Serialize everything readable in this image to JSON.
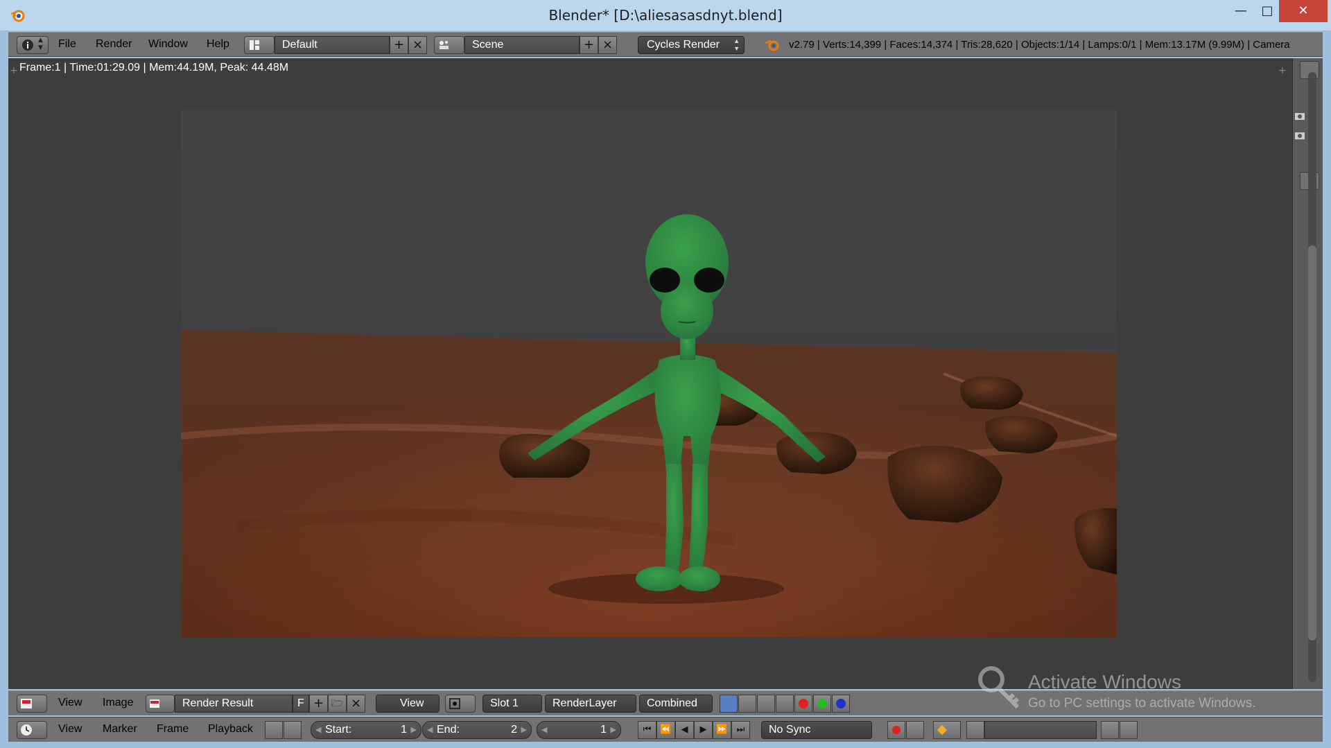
{
  "window": {
    "title": "Blender* [D:\\aliesasasdnyt.blend]"
  },
  "info_header": {
    "menus": [
      "File",
      "Render",
      "Window",
      "Help"
    ],
    "screen_layout": "Default",
    "scene": "Scene",
    "render_engine": "Cycles Render",
    "stats": "v2.79 | Verts:14,399 | Faces:14,374 | Tris:28,620 | Objects:1/14 | Lamps:0/1 | Mem:13.17M (9.99M) | Camera"
  },
  "image_editor": {
    "render_status": "Frame:1 | Time:01:29.09 | Mem:44.19M, Peak: 44.48M"
  },
  "image_header": {
    "menus": [
      "View",
      "Image"
    ],
    "image_name": "Render Result",
    "fake_user": "F",
    "view_label": "View",
    "slot": "Slot 1",
    "render_layer": "RenderLayer",
    "pass": "Combined"
  },
  "timeline_header": {
    "menus": [
      "View",
      "Marker",
      "Frame",
      "Playback"
    ],
    "start_label": "Start:",
    "start_value": "1",
    "end_label": "End:",
    "end_value": "2",
    "current_frame": "1",
    "sync": "No Sync"
  },
  "watermark": {
    "line1": "Activate Windows",
    "line2": "Go to PC settings to activate Windows."
  },
  "colors": {
    "header_bg": "#727272",
    "editor_bg": "#3d3d3d",
    "title_bar": "#bcd6ee",
    "close_button": "#c7443a",
    "alien_green": "#2f8c3f",
    "ground_brown": "#8a4a2c"
  }
}
